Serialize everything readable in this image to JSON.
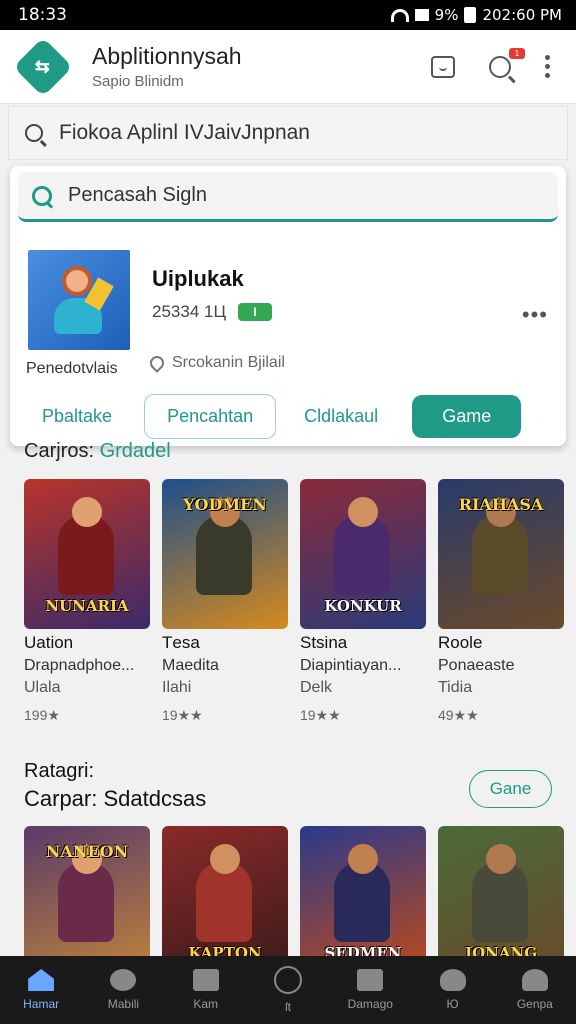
{
  "status": {
    "time": "18:33",
    "battery": "9%",
    "right_time": "202:60 PM"
  },
  "appbar": {
    "title": "Abplitionnysah",
    "subtitle": "Sapio Blinidm",
    "logo_glyph": "⇆",
    "notif_count": "1"
  },
  "search": {
    "text": "Fiokoa Aplinl IVJaivJnpnan"
  },
  "card": {
    "search_text": "Pencasah Sigln",
    "thumb_label": "Penedotvlais",
    "app_title": "Uiplukak",
    "meta": "25334 1Ц",
    "badge": "I",
    "location": "Srcokanin Bjilail",
    "actions": {
      "link1": "Pbaltake",
      "outline": "Pencahtan",
      "link2": "Cldlakaul",
      "primary": "Game"
    }
  },
  "section1": {
    "prefix": "Carjros:",
    "accent": "Grdadel"
  },
  "games_row1": [
    {
      "name": "Uation",
      "dev": "Drapnadphoe...",
      "cat": "Ulala",
      "rating": "199★",
      "caption": "NUNARIA",
      "colors": [
        "#b8342a",
        "#3a2a6a"
      ]
    },
    {
      "name": "Tеsa",
      "dev": "Maedita",
      "cat": "Ilahi",
      "rating": "19★★",
      "caption": "YODMEN",
      "colors": [
        "#1e4f8c",
        "#d68a1e"
      ]
    },
    {
      "name": "Stsina",
      "dev": "Diapintiayan...",
      "cat": "Delk",
      "rating": "19★★",
      "caption": "KONKUR",
      "colors": [
        "#8a2a3a",
        "#2a3a7a"
      ]
    },
    {
      "name": "Roole",
      "dev": "Ponaeaste",
      "cat": "Tidia",
      "rating": "49★★",
      "caption": "RIAHASA",
      "colors": [
        "#2a3a6a",
        "#6a4a2a"
      ]
    }
  ],
  "section2": {
    "title": "Ratagri:",
    "subtitle": "Carpar: Sdatdcsas",
    "button": "Gane"
  },
  "games_row2": [
    {
      "caption_top": "NANEON",
      "colors": [
        "#5a3a6a",
        "#c0843a"
      ]
    },
    {
      "caption": "KAPTON",
      "colors": [
        "#8a2a2a",
        "#3a1a1a"
      ]
    },
    {
      "caption": "SEDMEN",
      "colors": [
        "#2a3a8a",
        "#c04a1a"
      ]
    },
    {
      "caption": "JONANG",
      "colors": [
        "#4a6a3a",
        "#6a4a2a"
      ]
    }
  ],
  "nav": [
    {
      "label": "Hamar",
      "icon": "home-icon",
      "active": true
    },
    {
      "label": "Mabili",
      "icon": "chat-icon"
    },
    {
      "label": "Kam",
      "icon": "news-icon"
    },
    {
      "label": "ſt",
      "icon": "target-icon"
    },
    {
      "label": "Damago",
      "icon": "image-icon"
    },
    {
      "label": "Ю",
      "icon": "game-icon"
    },
    {
      "label": "Genpa",
      "icon": "person-icon"
    }
  ],
  "theme": {
    "accent": "#1f9a86"
  }
}
